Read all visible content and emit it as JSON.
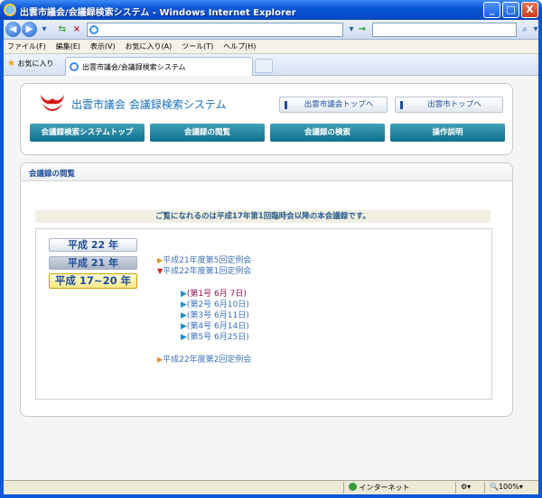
{
  "window": {
    "title": "出雲市議会/会議録検索システム - Windows Internet Explorer",
    "controls": [
      "_",
      "□",
      "X"
    ]
  },
  "menubar": {
    "items": [
      "ファイル(F)",
      "編集(E)",
      "表示(V)",
      "お気に入り(A)",
      "ツール(T)",
      "ヘルプ(H)"
    ]
  },
  "tabbar": {
    "favorites_label": "お気に入り",
    "tab_title": "出雲市議会/会議録検索システム"
  },
  "header": {
    "site_title": "出雲市議会 会議録検索システム",
    "link_council_top": "出雲市議会トップへ",
    "link_city_top": "出雲市トップへ",
    "nav": [
      "会議録検索システムトップ",
      "会議録の閲覧",
      "会議録の検索",
      "操作説明"
    ]
  },
  "main": {
    "heading": "会議録の閲覧",
    "notice": "ご覧になれるのは平成17年第1回臨時会以降の本会議録です。",
    "year_buttons": [
      "平成 22 年",
      "平成 21 年",
      "平成 17~20 年"
    ],
    "sessions": {
      "s1": {
        "marker": "▶",
        "label": "平成21年度第5回定例会"
      },
      "s2": {
        "marker": "▼",
        "label": "平成22年度第1回定例会"
      },
      "s3": {
        "marker": "▶",
        "label": "平成22年度第2回定例会"
      }
    },
    "issues": [
      {
        "marker": "▶",
        "label": "(第1号 6月 7日)"
      },
      {
        "marker": "▶",
        "label": "(第2号 6月10日)"
      },
      {
        "marker": "▶",
        "label": "(第3号 6月11日)"
      },
      {
        "marker": "▶",
        "label": "(第4号 6月14日)"
      },
      {
        "marker": "▶",
        "label": "(第5号 6月25日)"
      }
    ]
  },
  "status": {
    "zone": "インターネット",
    "zoom": "100%"
  },
  "colors": {
    "accent": "#1e4c9a",
    "nav_tab": "#0e6f8b",
    "title_blue": "#1a6fb5"
  }
}
